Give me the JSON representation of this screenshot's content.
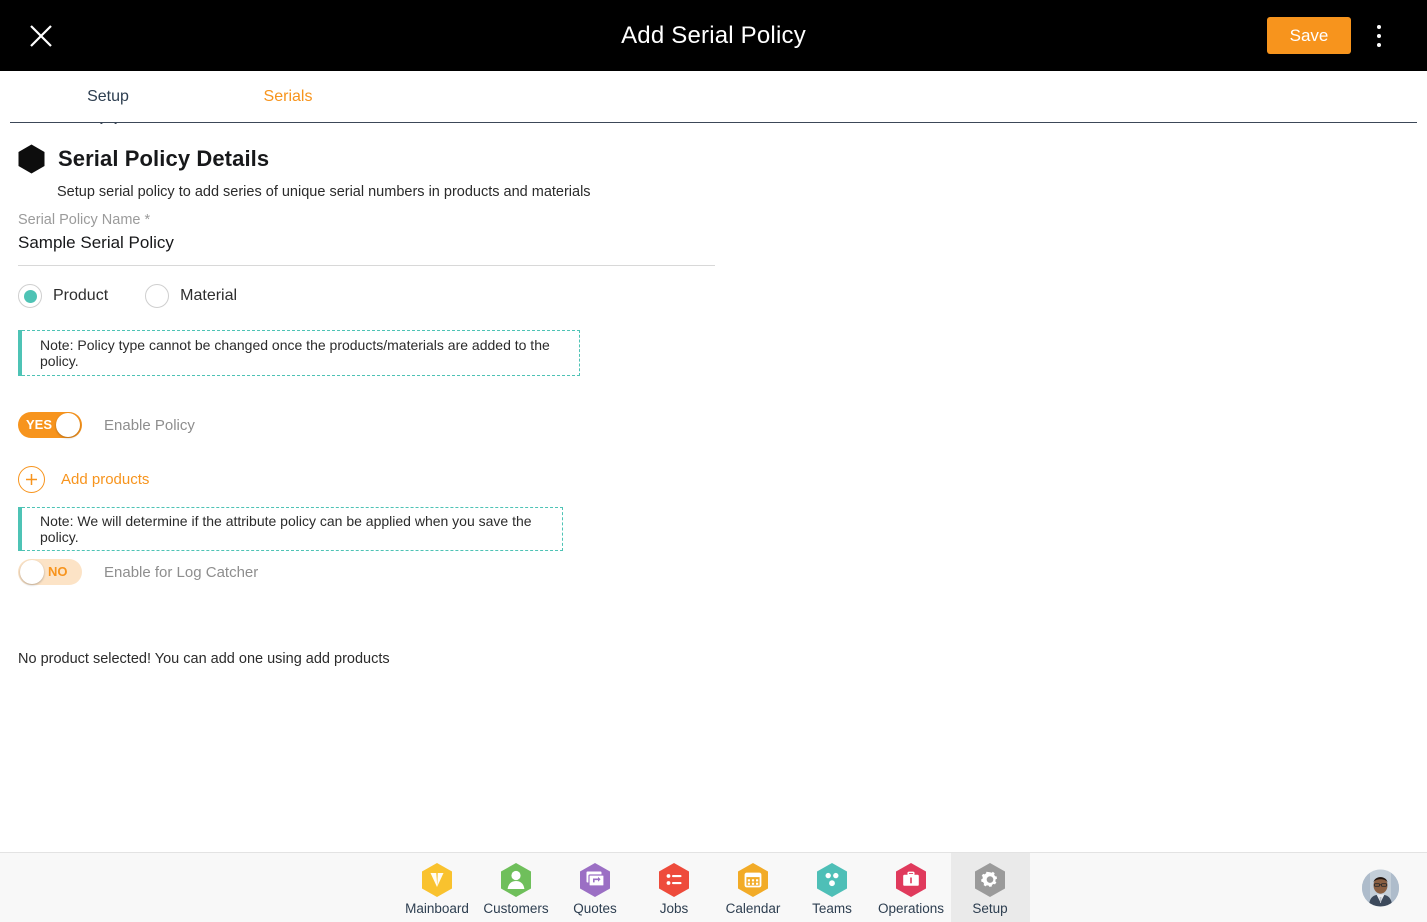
{
  "topbar": {
    "title": "Add Serial Policy",
    "close_icon": "close-icon",
    "save_label": "Save",
    "menu_icon": "kebab-menu-icon",
    "accent_color": "#f7941d"
  },
  "tabs": [
    {
      "label": "Setup",
      "active": true
    },
    {
      "label": "Serials",
      "active": false
    }
  ],
  "section": {
    "bullet_icon": "hexagon-icon",
    "title": "Serial Policy Details",
    "subtitle": "Setup serial policy to add series of unique serial numbers in products and materials"
  },
  "form": {
    "policy_name": {
      "label": "Serial Policy Name *",
      "value": "Sample Serial Policy",
      "placeholder": "Serial Policy Name"
    },
    "policy_type": {
      "selected": "Product",
      "options": [
        {
          "label": "Product",
          "selected": true
        },
        {
          "label": "Material",
          "selected": false
        }
      ],
      "selected_color": "#4ec3b5"
    },
    "note_policy_type": "Note: Policy type cannot be changed once the products/materials are added to the policy.",
    "enable_policy": {
      "state_label": "YES",
      "label": "Enable Policy",
      "on": true
    },
    "add_products": {
      "icon": "plus-circle-icon",
      "label": "Add products"
    },
    "note_attribute_policy": "Note: We will determine if the attribute policy can be applied when you save the policy.",
    "enable_log_catcher": {
      "state_label": "NO",
      "label": "Enable for Log Catcher",
      "on": false
    },
    "empty_message": "No product selected! You can add one using add products",
    "note_accent_color": "#4ec3b5"
  },
  "bottom_nav": {
    "items": [
      {
        "label": "Mainboard",
        "icon": "mainboard-icon",
        "color": "#f9c22e",
        "active": false
      },
      {
        "label": "Customers",
        "icon": "customers-icon",
        "color": "#6fbf5b",
        "active": false
      },
      {
        "label": "Quotes",
        "icon": "quotes-icon",
        "color": "#9b6fc4",
        "active": false
      },
      {
        "label": "Jobs",
        "icon": "jobs-icon",
        "color": "#ee4b3b",
        "active": false
      },
      {
        "label": "Calendar",
        "icon": "calendar-icon",
        "color": "#f2ab27",
        "active": false
      },
      {
        "label": "Teams",
        "icon": "teams-icon",
        "color": "#4ebfb7",
        "active": false
      },
      {
        "label": "Operations",
        "icon": "operations-icon",
        "color": "#e03a5c",
        "active": false
      },
      {
        "label": "Setup",
        "icon": "gear-icon",
        "color": "#9a9a9a",
        "active": true
      }
    ],
    "avatar": "user-avatar"
  }
}
